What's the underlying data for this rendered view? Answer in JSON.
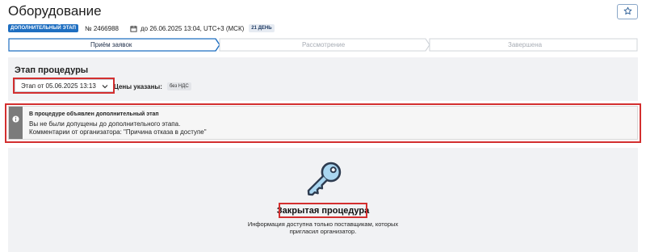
{
  "header": {
    "title": "Оборудование"
  },
  "meta": {
    "stage_badge": "ДОПОЛНИТЕЛЬНЫЙ ЭТАП",
    "number": "№ 2466988",
    "deadline": "до 26.06.2025 13:04, UTC+3 (МСК)",
    "days_badge": "21 ДЕНЬ"
  },
  "steps": [
    {
      "label": "Приём заявок",
      "state": "active"
    },
    {
      "label": "Рассмотрение",
      "state": "inactive"
    },
    {
      "label": "Завершена",
      "state": "inactive"
    }
  ],
  "procedure_stage": {
    "title": "Этап процедуры",
    "selected_stage": "Этап от 05.06.2025 13:13",
    "prices_label": "Цены указаны:",
    "prices_value": "без НДС"
  },
  "alert": {
    "title": "В процедуре объявлен дополнительный этап",
    "line1": "Вы не были допущены до дополнительного этапа.",
    "line2": "Комментарии от организатора: \"Причина отказа в доступе\""
  },
  "closed": {
    "title": "Закрытая процедура",
    "line1": "Информация доступна только поставщикам, которых",
    "line2": "пригласил организатор."
  },
  "colors": {
    "accent": "#1f6fc1",
    "highlight": "#d32f2f",
    "panel": "#f1f2f4",
    "key": "#a9d6f0"
  },
  "icons": [
    "star-icon",
    "calendar-icon",
    "chevron-down-icon",
    "info-icon",
    "key-icon"
  ]
}
